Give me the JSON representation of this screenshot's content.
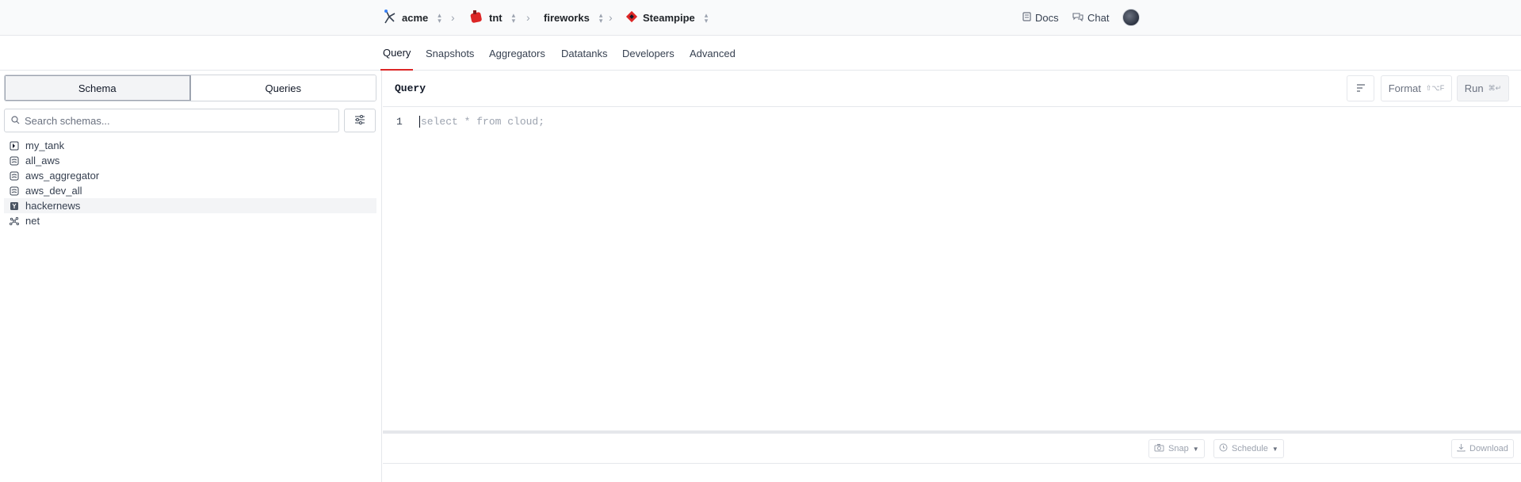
{
  "breadcrumb": {
    "org": "acme",
    "workspace": "tnt",
    "project": "fireworks",
    "product": "Steampipe"
  },
  "toplinks": {
    "docs": "Docs",
    "chat": "Chat"
  },
  "tabs": [
    "Query",
    "Snapshots",
    "Aggregators",
    "Datatanks",
    "Developers",
    "Advanced"
  ],
  "left": {
    "segments": [
      "Schema",
      "Queries"
    ],
    "search_placeholder": "Search schemas...",
    "schemas": [
      {
        "name": "my_tank",
        "icon": "datatank-icon"
      },
      {
        "name": "all_aws",
        "icon": "aggregator-icon"
      },
      {
        "name": "aws_aggregator",
        "icon": "aggregator-icon"
      },
      {
        "name": "aws_dev_all",
        "icon": "aggregator-icon"
      },
      {
        "name": "hackernews",
        "icon": "hackernews-icon"
      },
      {
        "name": "net",
        "icon": "net-icon"
      }
    ]
  },
  "query": {
    "title": "Query",
    "format_label": "Format",
    "format_shortcut": "⇧⌥F",
    "run_label": "Run",
    "run_shortcut": "⌘↵",
    "line_number": "1",
    "placeholder": "select * from cloud;"
  },
  "bottom": {
    "snap_label": "Snap",
    "schedule_label": "Schedule",
    "download_label": "Download"
  },
  "colors": {
    "accent": "#dc2626"
  }
}
